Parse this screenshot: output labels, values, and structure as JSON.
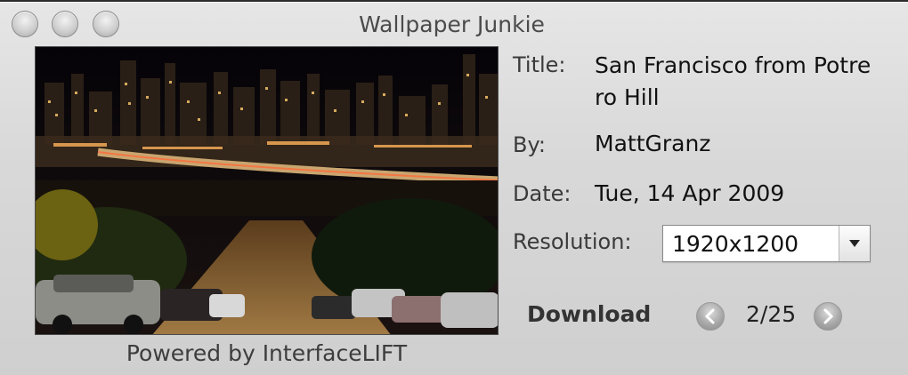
{
  "window": {
    "title": "Wallpaper Junkie",
    "buttons": [
      "close-icon",
      "minimize-icon",
      "zoom-icon"
    ]
  },
  "wallpaper": {
    "image": "night-city-skyline-photo",
    "powered_by": "Powered by InterfaceLIFT"
  },
  "details": {
    "title_label": "Title:",
    "title_value": "San Francisco from Potrero Hill",
    "by_label": "By:",
    "by_value": "MattGranz",
    "date_label": "Date:",
    "date_value": "Tue, 14 Apr 2009",
    "resolution_label": "Resolution:",
    "resolution_value": "1920x1200"
  },
  "footer": {
    "download_label": "Download",
    "counter": "2/25",
    "prev_icon": "chevron-left-icon",
    "next_icon": "chevron-right-icon"
  }
}
